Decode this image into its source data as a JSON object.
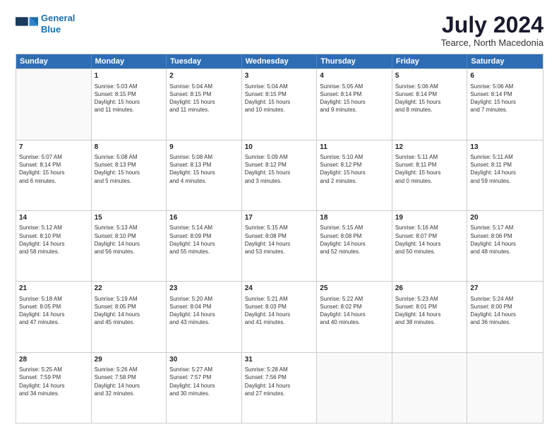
{
  "header": {
    "logo_line1": "General",
    "logo_line2": "Blue",
    "month_title": "July 2024",
    "location": "Tearce, North Macedonia"
  },
  "weekdays": [
    "Sunday",
    "Monday",
    "Tuesday",
    "Wednesday",
    "Thursday",
    "Friday",
    "Saturday"
  ],
  "weeks": [
    [
      {
        "day": "",
        "info": ""
      },
      {
        "day": "1",
        "info": "Sunrise: 5:03 AM\nSunset: 8:15 PM\nDaylight: 15 hours\nand 11 minutes."
      },
      {
        "day": "2",
        "info": "Sunrise: 5:04 AM\nSunset: 8:15 PM\nDaylight: 15 hours\nand 11 minutes."
      },
      {
        "day": "3",
        "info": "Sunrise: 5:04 AM\nSunset: 8:15 PM\nDaylight: 15 hours\nand 10 minutes."
      },
      {
        "day": "4",
        "info": "Sunrise: 5:05 AM\nSunset: 8:14 PM\nDaylight: 15 hours\nand 9 minutes."
      },
      {
        "day": "5",
        "info": "Sunrise: 5:06 AM\nSunset: 8:14 PM\nDaylight: 15 hours\nand 8 minutes."
      },
      {
        "day": "6",
        "info": "Sunrise: 5:06 AM\nSunset: 8:14 PM\nDaylight: 15 hours\nand 7 minutes."
      }
    ],
    [
      {
        "day": "7",
        "info": "Sunrise: 5:07 AM\nSunset: 8:14 PM\nDaylight: 15 hours\nand 6 minutes."
      },
      {
        "day": "8",
        "info": "Sunrise: 5:08 AM\nSunset: 8:13 PM\nDaylight: 15 hours\nand 5 minutes."
      },
      {
        "day": "9",
        "info": "Sunrise: 5:08 AM\nSunset: 8:13 PM\nDaylight: 15 hours\nand 4 minutes."
      },
      {
        "day": "10",
        "info": "Sunrise: 5:09 AM\nSunset: 8:12 PM\nDaylight: 15 hours\nand 3 minutes."
      },
      {
        "day": "11",
        "info": "Sunrise: 5:10 AM\nSunset: 8:12 PM\nDaylight: 15 hours\nand 2 minutes."
      },
      {
        "day": "12",
        "info": "Sunrise: 5:11 AM\nSunset: 8:11 PM\nDaylight: 15 hours\nand 0 minutes."
      },
      {
        "day": "13",
        "info": "Sunrise: 5:11 AM\nSunset: 8:11 PM\nDaylight: 14 hours\nand 59 minutes."
      }
    ],
    [
      {
        "day": "14",
        "info": "Sunrise: 5:12 AM\nSunset: 8:10 PM\nDaylight: 14 hours\nand 58 minutes."
      },
      {
        "day": "15",
        "info": "Sunrise: 5:13 AM\nSunset: 8:10 PM\nDaylight: 14 hours\nand 56 minutes."
      },
      {
        "day": "16",
        "info": "Sunrise: 5:14 AM\nSunset: 8:09 PM\nDaylight: 14 hours\nand 55 minutes."
      },
      {
        "day": "17",
        "info": "Sunrise: 5:15 AM\nSunset: 8:08 PM\nDaylight: 14 hours\nand 53 minutes."
      },
      {
        "day": "18",
        "info": "Sunrise: 5:15 AM\nSunset: 8:08 PM\nDaylight: 14 hours\nand 52 minutes."
      },
      {
        "day": "19",
        "info": "Sunrise: 5:16 AM\nSunset: 8:07 PM\nDaylight: 14 hours\nand 50 minutes."
      },
      {
        "day": "20",
        "info": "Sunrise: 5:17 AM\nSunset: 8:06 PM\nDaylight: 14 hours\nand 48 minutes."
      }
    ],
    [
      {
        "day": "21",
        "info": "Sunrise: 5:18 AM\nSunset: 8:05 PM\nDaylight: 14 hours\nand 47 minutes."
      },
      {
        "day": "22",
        "info": "Sunrise: 5:19 AM\nSunset: 8:05 PM\nDaylight: 14 hours\nand 45 minutes."
      },
      {
        "day": "23",
        "info": "Sunrise: 5:20 AM\nSunset: 8:04 PM\nDaylight: 14 hours\nand 43 minutes."
      },
      {
        "day": "24",
        "info": "Sunrise: 5:21 AM\nSunset: 8:03 PM\nDaylight: 14 hours\nand 41 minutes."
      },
      {
        "day": "25",
        "info": "Sunrise: 5:22 AM\nSunset: 8:02 PM\nDaylight: 14 hours\nand 40 minutes."
      },
      {
        "day": "26",
        "info": "Sunrise: 5:23 AM\nSunset: 8:01 PM\nDaylight: 14 hours\nand 38 minutes."
      },
      {
        "day": "27",
        "info": "Sunrise: 5:24 AM\nSunset: 8:00 PM\nDaylight: 14 hours\nand 36 minutes."
      }
    ],
    [
      {
        "day": "28",
        "info": "Sunrise: 5:25 AM\nSunset: 7:59 PM\nDaylight: 14 hours\nand 34 minutes."
      },
      {
        "day": "29",
        "info": "Sunrise: 5:26 AM\nSunset: 7:58 PM\nDaylight: 14 hours\nand 32 minutes."
      },
      {
        "day": "30",
        "info": "Sunrise: 5:27 AM\nSunset: 7:57 PM\nDaylight: 14 hours\nand 30 minutes."
      },
      {
        "day": "31",
        "info": "Sunrise: 5:28 AM\nSunset: 7:56 PM\nDaylight: 14 hours\nand 27 minutes."
      },
      {
        "day": "",
        "info": ""
      },
      {
        "day": "",
        "info": ""
      },
      {
        "day": "",
        "info": ""
      }
    ]
  ]
}
